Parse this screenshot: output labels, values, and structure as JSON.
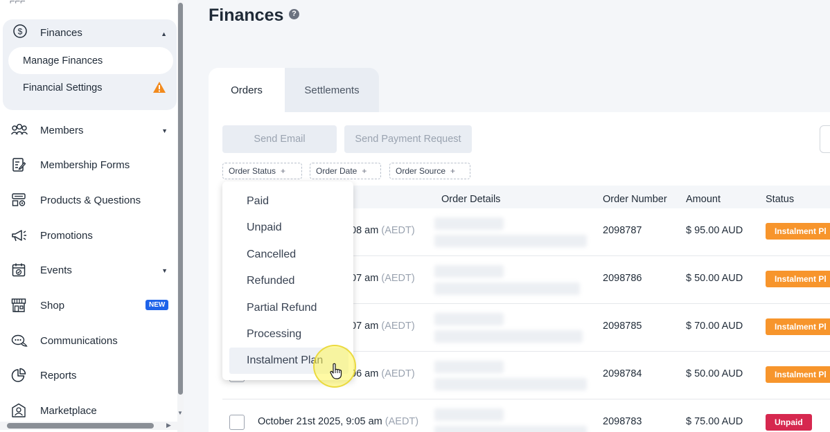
{
  "sidebar": {
    "finances": {
      "label": "Finances",
      "sub_items": [
        {
          "label": "Manage Finances",
          "active": true
        },
        {
          "label": "Financial Settings",
          "warning": true
        }
      ]
    },
    "items": [
      {
        "label": "Members",
        "icon": "members-icon",
        "has_caret": true
      },
      {
        "label": "Membership Forms",
        "icon": "forms-icon"
      },
      {
        "label": "Products & Questions",
        "icon": "products-icon"
      },
      {
        "label": "Promotions",
        "icon": "megaphone-icon"
      },
      {
        "label": "Events",
        "icon": "calendar-icon",
        "has_caret": true
      },
      {
        "label": "Shop",
        "icon": "shop-icon",
        "badge": "NEW"
      },
      {
        "label": "Communications",
        "icon": "chat-icon"
      },
      {
        "label": "Reports",
        "icon": "pie-chart-icon"
      },
      {
        "label": "Marketplace",
        "icon": "marketplace-icon"
      }
    ]
  },
  "main": {
    "title": "Finances",
    "help_icon": "?",
    "tabs": [
      {
        "label": "Orders",
        "active": true
      },
      {
        "label": "Settlements",
        "active": false
      }
    ],
    "buttons": {
      "send_email": "Send Email",
      "send_payment_request": "Send Payment Request"
    },
    "filters": {
      "order_status": "Order Status",
      "order_date": "Order Date",
      "order_source": "Order Source",
      "plus": "+"
    },
    "table": {
      "columns": {
        "order_details": "Order Details",
        "order_number": "Order Number",
        "amount": "Amount",
        "status": "Status"
      },
      "rows": [
        {
          "time": ":08 am",
          "tz": "(AEDT)",
          "order_number": "2098787",
          "amount": "$ 95.00 AUD",
          "status": "Instalment Pl"
        },
        {
          "time": ":07 am",
          "tz": "(AEDT)",
          "order_number": "2098786",
          "amount": "$ 50.00 AUD",
          "status": "Instalment Pl"
        },
        {
          "time": ":07 am",
          "tz": "(AEDT)",
          "order_number": "2098785",
          "amount": "$ 70.00 AUD",
          "status": "Instalment Pl"
        },
        {
          "time": ":06 am",
          "tz": "(AEDT)",
          "order_number": "2098784",
          "amount": "$ 50.00 AUD",
          "status": "Instalment Pl"
        },
        {
          "time": "October 21st 2025, 9:05 am",
          "tz": "(AEDT)",
          "order_number": "2098783",
          "amount": "$ 75.00 AUD",
          "status": "Unpaid"
        }
      ]
    }
  },
  "dropdown": {
    "options": [
      "Paid",
      "Unpaid",
      "Cancelled",
      "Refunded",
      "Partial Refund",
      "Processing",
      "Instalment Plan"
    ],
    "hovered": "Instalment Plan"
  },
  "colors": {
    "instalment": "#f7952c",
    "unpaid": "#d6284f",
    "new_badge": "#1e63e9",
    "warning": "#f28a1d"
  }
}
